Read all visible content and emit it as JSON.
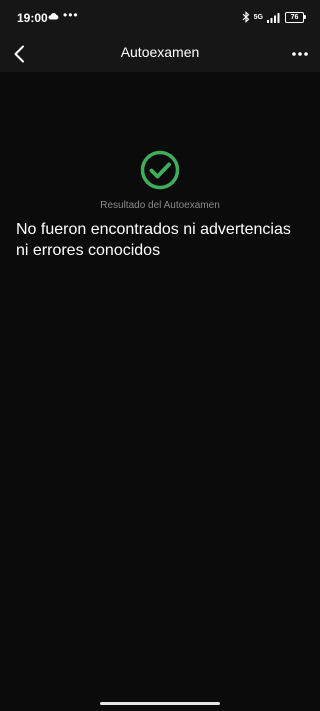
{
  "status_bar": {
    "time": "19:00",
    "dots": "•••",
    "network": "5G",
    "battery": "76"
  },
  "app_bar": {
    "title": "Autoexamen"
  },
  "result": {
    "label": "Resultado del Autoexamen",
    "message": "No fueron encontrados ni advertencias ni errores conocidos"
  },
  "colors": {
    "background": "#0b0b0b",
    "bar_background": "#161616",
    "success_green": "#3fae5a",
    "label_gray": "#8a8a8a"
  },
  "icons": {
    "back": "back-arrow-icon",
    "more": "more-options-icon",
    "result": "check-circle-icon"
  }
}
